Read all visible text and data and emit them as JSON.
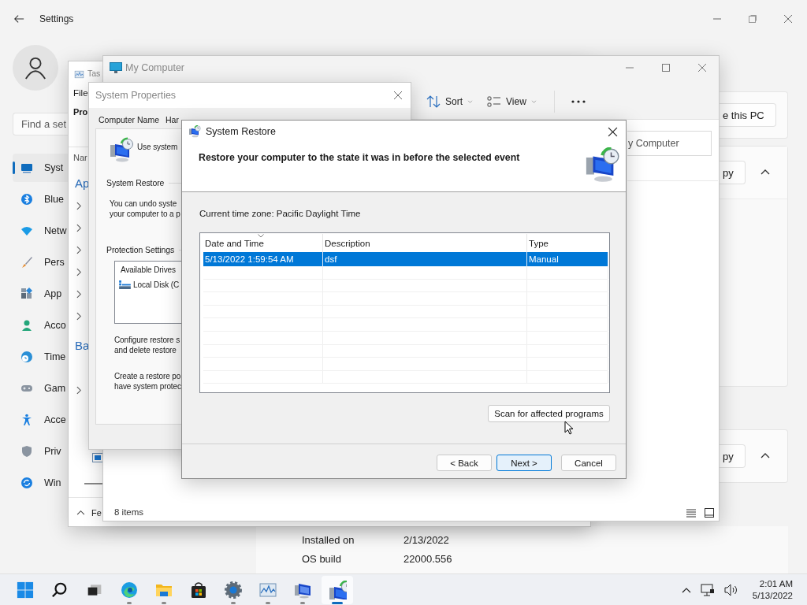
{
  "settings": {
    "title": "Settings",
    "search": {
      "placeholder": "Find a set"
    },
    "nav": [
      {
        "label": "Syst",
        "selected": true
      },
      {
        "label": "Blue",
        "selected": false
      },
      {
        "label": "Netw",
        "selected": false
      },
      {
        "label": "Pers",
        "selected": false
      },
      {
        "label": "App",
        "selected": false
      },
      {
        "label": "Acco",
        "selected": false
      },
      {
        "label": "Time",
        "selected": false
      },
      {
        "label": "Gam",
        "selected": false
      },
      {
        "label": "Acce",
        "selected": false
      },
      {
        "label": "Priv",
        "selected": false
      },
      {
        "label": "Win",
        "selected": false
      }
    ],
    "cards": [
      {
        "kind": "button",
        "button": "e this PC"
      },
      {
        "kind": "expander",
        "button": "py",
        "expanded": true
      },
      {
        "kind": "expander",
        "button": "py",
        "expanded": true
      }
    ],
    "info": [
      {
        "label": "Installed on",
        "value": "2/13/2022"
      },
      {
        "label": "OS build",
        "value": "22000.556"
      }
    ]
  },
  "task_manager": {
    "title": "Tas",
    "menu": "File",
    "tab": "Pro",
    "column": "Nar",
    "groups": [
      "Ap",
      "Ba"
    ],
    "footer": "Fe"
  },
  "explorer": {
    "title": "My Computer",
    "toolbar": [
      {
        "label": "Sort"
      },
      {
        "label": "View"
      }
    ],
    "address": "y Computer",
    "status": "8 items"
  },
  "system_properties": {
    "title": "System Properties",
    "tabs": [
      {
        "label": "Computer Name",
        "selected": false
      },
      {
        "label": "Har",
        "selected": false
      }
    ],
    "intro": "Use system",
    "restore_group": "System Restore",
    "restore_text": [
      "You can undo syste",
      "your computer to a p"
    ],
    "protection_group": "Protection Settings",
    "drives_header": "Available Drives",
    "drives": [
      "Local Disk (C"
    ],
    "configure_text": [
      "Configure restore s",
      "and delete restore"
    ],
    "create_text": [
      "Create a restore po",
      "have system protec"
    ]
  },
  "system_restore": {
    "title": "System Restore",
    "heading": "Restore your computer to the state it was in before the selected event",
    "timezone": "Current time zone: Pacific Daylight Time",
    "columns": [
      "Date and Time",
      "Description",
      "Type"
    ],
    "rows": [
      {
        "date": "5/13/2022 1:59:54 AM",
        "description": "dsf",
        "type": "Manual",
        "selected": true
      }
    ],
    "scan_button": "Scan for affected programs",
    "buttons": [
      {
        "label": "< Back",
        "default": false
      },
      {
        "label": "Next >",
        "default": true
      },
      {
        "label": "Cancel",
        "default": false
      }
    ]
  },
  "taskbar": {
    "apps": [
      {
        "running": true,
        "active": false
      },
      {
        "running": true,
        "active": false
      },
      {
        "running": false,
        "active": false
      },
      {
        "running": true,
        "active": false
      },
      {
        "running": true,
        "active": false
      },
      {
        "running": true,
        "active": false
      },
      {
        "running": true,
        "active": true
      }
    ],
    "time": "2:01 AM",
    "date": "5/13/2022"
  }
}
